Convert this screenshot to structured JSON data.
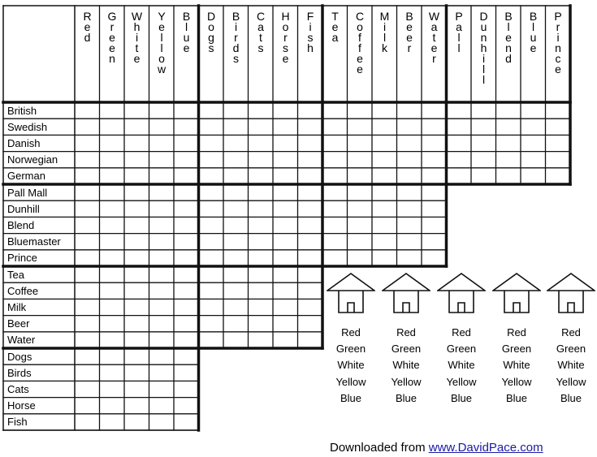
{
  "puzzle": {
    "column_groups": [
      {
        "name": "colors",
        "items": [
          "Red",
          "Green",
          "White",
          "Yellow",
          "Blue"
        ]
      },
      {
        "name": "pets",
        "items": [
          "Dogs",
          "Birds",
          "Cats",
          "Horse",
          "Fish"
        ]
      },
      {
        "name": "drinks",
        "items": [
          "Tea",
          "Coffee",
          "Milk",
          "Beer",
          "Water"
        ]
      },
      {
        "name": "cigars",
        "items": [
          "Pall",
          "Dunhill",
          "Blend",
          "Blue",
          "Prince"
        ]
      }
    ],
    "row_groups": [
      {
        "name": "nationalities",
        "items": [
          "British",
          "Swedish",
          "Danish",
          "Norwegian",
          "German"
        ],
        "span_cols": 4
      },
      {
        "name": "cigars",
        "items": [
          "Pall Mall",
          "Dunhill",
          "Blend",
          "Bluemaster",
          "Prince"
        ],
        "span_cols": 3
      },
      {
        "name": "drinks",
        "items": [
          "Tea",
          "Coffee",
          "Milk",
          "Beer",
          "Water"
        ],
        "span_cols": 2
      },
      {
        "name": "pets",
        "items": [
          "Dogs",
          "Birds",
          "Cats",
          "Horse",
          "Fish"
        ],
        "span_cols": 1
      }
    ]
  },
  "houses": {
    "count": 5,
    "color_options": [
      "Red",
      "Green",
      "White",
      "Yellow",
      "Blue"
    ]
  },
  "footer": {
    "prefix": "Downloaded from ",
    "link_text": "www.DavidPace.com"
  }
}
